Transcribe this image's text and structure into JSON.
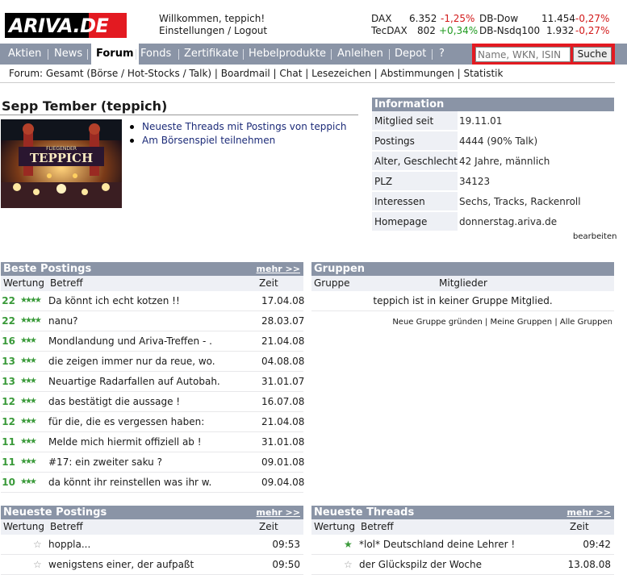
{
  "header": {
    "logo_text": "ARIVA.DE",
    "welcome": "Willkommen, teppich!",
    "settings_logout": "Einstellungen / Logout",
    "tickers": [
      {
        "name": "DAX",
        "value": "6.352",
        "change": "-1,25%",
        "dir": "neg"
      },
      {
        "name": "DB-Dow",
        "value": "11.454",
        "change": "-0,27%",
        "dir": "neg"
      },
      {
        "name": "TecDAX",
        "value": "802",
        "change": "+0,34%",
        "dir": "pos"
      },
      {
        "name": "DB-Nsdq100",
        "value": "1.932",
        "change": "-0,27%",
        "dir": "neg"
      }
    ]
  },
  "nav": {
    "items": [
      "Aktien",
      "News",
      "Forum",
      "Fonds",
      "Zertifikate",
      "Hebelprodukte",
      "Anleihen",
      "Depot",
      "?"
    ],
    "active": "Forum",
    "search_placeholder": "Name, WKN, ISIN",
    "search_button": "Suche"
  },
  "subnav": "Forum: Gesamt (Börse / Hot-Stocks / Talk) | Boardmail | Chat | Lesezeichen | Abstimmungen | Statistik",
  "profile": {
    "title": "Sepp Tember (teppich)",
    "avatar_text": "TEPPICH",
    "avatar_subtext": "FLIEGENDER",
    "links": [
      "Neueste Threads mit Postings von teppich",
      "Am Börsenspiel teilnehmen"
    ]
  },
  "info": {
    "title": "Information",
    "rows": [
      {
        "k": "Mitglied seit",
        "v": "19.11.01"
      },
      {
        "k": "Postings",
        "v": "4444 (90% Talk)"
      },
      {
        "k": "Alter, Geschlecht",
        "v": "42 Jahre, männlich"
      },
      {
        "k": "PLZ",
        "v": "34123"
      },
      {
        "k": "Interessen",
        "v": "Sechs, Tracks, Rackenroll"
      },
      {
        "k": "Homepage",
        "v": "donnerstag.ariva.de"
      }
    ],
    "edit": "bearbeiten"
  },
  "best": {
    "title": "Beste Postings",
    "more": "mehr >>",
    "cols": [
      "Wertung",
      "Betreff",
      "Zeit"
    ],
    "rows": [
      {
        "score": "22",
        "stars": 4,
        "subject": "Da könnt ich echt kotzen !!",
        "time": "17.04.08"
      },
      {
        "score": "22",
        "stars": 4,
        "subject": "nanu?",
        "time": "28.03.07"
      },
      {
        "score": "16",
        "stars": 3,
        "subject": "Mondlandung und Ariva-Treffen - .",
        "time": "21.04.08"
      },
      {
        "score": "13",
        "stars": 3,
        "subject": "die zeigen immer nur da reue, wo.",
        "time": "04.08.08"
      },
      {
        "score": "13",
        "stars": 3,
        "subject": "Neuartige Radarfallen auf Autobah.",
        "time": "31.01.07"
      },
      {
        "score": "12",
        "stars": 3,
        "subject": "das bestätigt die aussage !",
        "time": "16.07.08"
      },
      {
        "score": "12",
        "stars": 3,
        "subject": "für die, die es vergessen haben:",
        "time": "21.04.08"
      },
      {
        "score": "11",
        "stars": 3,
        "subject": "Melde mich hiermit offiziell ab !",
        "time": "31.01.08"
      },
      {
        "score": "11",
        "stars": 3,
        "subject": "#17: ein zweiter saku ?",
        "time": "09.01.08"
      },
      {
        "score": "10",
        "stars": 3,
        "subject": "da könnt ihr reinstellen was ihr w.",
        "time": "09.04.08"
      }
    ]
  },
  "groups": {
    "title": "Gruppen",
    "cols": [
      "Gruppe",
      "Mitglieder"
    ],
    "empty": "teppich ist in keiner Gruppe Mitglied.",
    "links": "Neue Gruppe gründen | Meine Gruppen | Alle Gruppen"
  },
  "newest_postings": {
    "title": "Neueste Postings",
    "more": "mehr >>",
    "cols": [
      "Wertung",
      "Betreff",
      "Zeit"
    ],
    "rows": [
      {
        "star": "empty",
        "subject": "hoppla...",
        "time": "09:53"
      },
      {
        "star": "empty",
        "subject": "wenigstens einer, der aufpaßt",
        "time": "09:50"
      }
    ]
  },
  "newest_threads": {
    "title": "Neueste Threads",
    "more": "mehr >>",
    "cols": [
      "Wertung",
      "Betreff",
      "Zeit"
    ],
    "rows": [
      {
        "star": "full",
        "subject": "*lol* Deutschland deine Lehrer !",
        "time": "09:42"
      },
      {
        "star": "empty",
        "subject": "der Glückspilz der Woche",
        "time": "13.08.08"
      }
    ]
  },
  "colors": {
    "nav_bg": "#8a94a6",
    "brand_red": "#e31a21",
    "score_green": "#3a9a3a"
  }
}
